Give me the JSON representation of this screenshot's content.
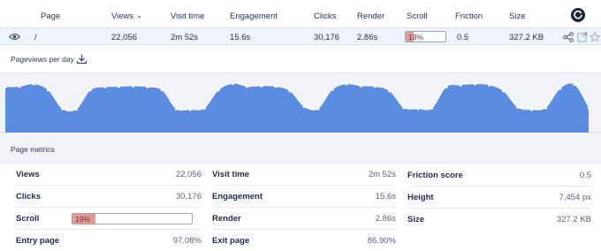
{
  "table": {
    "headers": {
      "page": "Page",
      "views": "Views",
      "visit_time": "Visit time",
      "engagement": "Engagement",
      "clicks": "Clicks",
      "render": "Render",
      "scroll": "Scroll",
      "friction": "Friction",
      "size": "Size"
    },
    "sorted_column": "views",
    "row": {
      "page": "/",
      "views": "22,056",
      "visit_time": "2m 52s",
      "engagement": "15.6s",
      "clicks": "30,176",
      "render": "2.86s",
      "scroll": "19%",
      "scroll_fraction": 0.19,
      "friction": "0.5",
      "size": "327.2 KB"
    },
    "row_actions": [
      "share-icon",
      "open-external-icon",
      "star-icon"
    ]
  },
  "graph": {
    "title": "Pageviews per day",
    "color": "#5a8de2",
    "chart_data": {
      "type": "area",
      "values": [
        92,
        93,
        98,
        86,
        48,
        47,
        86,
        92,
        93,
        94,
        92,
        86,
        48,
        46,
        49,
        86,
        99,
        93,
        94,
        93,
        84,
        52,
        48,
        87,
        98,
        94,
        93,
        84,
        50,
        48,
        49,
        92,
        96,
        98,
        96,
        84,
        51,
        46,
        50,
        89,
        97,
        50
      ],
      "ylim": [
        0,
        120
      ]
    }
  },
  "metrics": {
    "title": "Page metrics",
    "col1": [
      {
        "label": "Views",
        "value": "22,056"
      },
      {
        "label": "Clicks",
        "value": "30,176"
      },
      {
        "label": "Scroll",
        "value": "19%",
        "fraction": 0.19
      },
      {
        "label": "Entry page",
        "value": "97.08%"
      }
    ],
    "col2": [
      {
        "label": "Visit time",
        "value": "2m 52s"
      },
      {
        "label": "Engagement",
        "value": "15.6s"
      },
      {
        "label": "Render",
        "value": "2.86s"
      },
      {
        "label": "Exit page",
        "value": "86.90%"
      }
    ],
    "col3": [
      {
        "label": "Friction score",
        "value": "0.5"
      },
      {
        "label": "Height",
        "value": "7,454 px"
      },
      {
        "label": "Size",
        "value": "327.2 KB"
      }
    ]
  },
  "colors": {
    "accent": "#5a8de2",
    "scroll_fill": "#e59a9a",
    "row_highlight": "#eef3fc"
  }
}
